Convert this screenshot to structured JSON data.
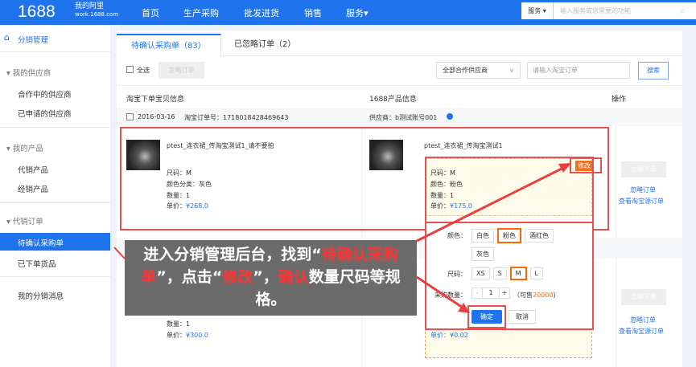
{
  "header": {
    "logo": "1688",
    "brand": "我的阿里",
    "brand_sub": "work.1688.com",
    "nav": [
      "首页",
      "生产采购",
      "批发进货",
      "销售",
      "服务▾"
    ],
    "search_scope": "服务 ▾",
    "search_placeholder": "输入服务或您需要的功能"
  },
  "sidebar": {
    "title": "分销管理",
    "groups": [
      {
        "label": "▾ 我的供应商",
        "items": [
          "合作中的供应商",
          "已申请的供应商"
        ]
      },
      {
        "label": "▾ 我的产品",
        "items": [
          "代销产品",
          "经销产品"
        ]
      },
      {
        "label": "▾ 代销订单",
        "items": [
          "待确认采购单",
          "已下单货品"
        ]
      }
    ],
    "extra": "我的分销消息",
    "active": "待确认采购单"
  },
  "tabs": [
    "待确认采购单（83）",
    "已忽略订单（2）"
  ],
  "toolbar": {
    "select_all": "全选",
    "ignore": "忽略订单",
    "supplier_select": "全部合作供应商",
    "order_placeholder": "请输入淘宝订单",
    "search": "搜索"
  },
  "columns": [
    "淘宝下单宝贝信息",
    "1688产品信息",
    "操作"
  ],
  "order": {
    "date": "2016-03-16",
    "order_no": "淘宝订单号：1718018428469643",
    "supplier": "供应商：b测试账号001",
    "taobao": {
      "title": "ptest_连衣裙_传淘宝测试1_请不要拍",
      "size": "尺码：M",
      "color": "颜色分类：灰色",
      "qty": "数量：1",
      "price_label": "单价：",
      "price": "¥268.0"
    },
    "ali": {
      "title": "ptest_连衣裙_传淘宝测试1",
      "size": "尺码：M",
      "color": "颜色：粉色",
      "qty": "数量：1",
      "price_label": "单价：",
      "price": "¥175.0",
      "edit": "修改"
    },
    "actions": {
      "place": "立即下单",
      "ignore": "忽略订单",
      "view": "查看淘宝源订单"
    }
  },
  "popup": {
    "color_label": "颜色：",
    "colors": [
      "白色",
      "粉色",
      "酒红色",
      "灰色"
    ],
    "size_label": "尺码：",
    "sizes": [
      "XS",
      "S",
      "M",
      "L"
    ],
    "qty_label": "采购数量：",
    "qty": "1",
    "avail_pre": "（可售",
    "avail": "20000",
    "avail_post": "）",
    "ok": "确定",
    "cancel": "取消"
  },
  "order2": {
    "qty": "数量：1",
    "price_label": "单价：",
    "price": "¥300.0",
    "ali_price": "单价：¥0.02",
    "actions": {
      "place": "立即下单",
      "ignore": "忽略订单",
      "view": "查看淘宝源订单"
    }
  },
  "callout": {
    "p1": "进入分销管理后台，找到“",
    "h1": "待确认采购单",
    "p2": "”，点击“",
    "h2": "修改",
    "p3": "”，",
    "h3": "确认",
    "p4": "数量尺码等规格。"
  }
}
